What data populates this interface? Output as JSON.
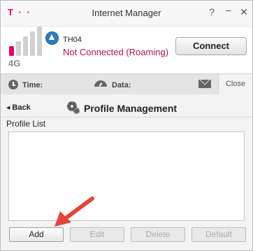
{
  "window": {
    "title": "Internet Manager",
    "logo_text": "T · ·",
    "help_label": "?",
    "minimize_label": "–",
    "close_label": "✕"
  },
  "status": {
    "network_type": "4G",
    "network_name": "TH04",
    "connection_status": "Not Connected (Roaming)",
    "connect_label": "Connect",
    "signal_bars_filled": 1,
    "signal_bars_total": 5
  },
  "info": {
    "time_label": "Time:",
    "data_label": "Data:",
    "close_tab_label": "Close"
  },
  "page": {
    "back_label": "Back",
    "title": "Profile Management",
    "list_label": "Profile List",
    "profiles": []
  },
  "buttons": {
    "add": "Add",
    "edit": "Edit",
    "delete": "Delete",
    "default": "Default"
  },
  "colors": {
    "brand_magenta": "#e20074",
    "status_red": "#b0124a",
    "annotation_arrow": "#e2453b"
  },
  "icons": {
    "roaming": "roaming-triangle-icon",
    "time": "clock-icon",
    "data": "gauge-icon",
    "messages": "mail-icon",
    "settings": "gear-icon"
  }
}
